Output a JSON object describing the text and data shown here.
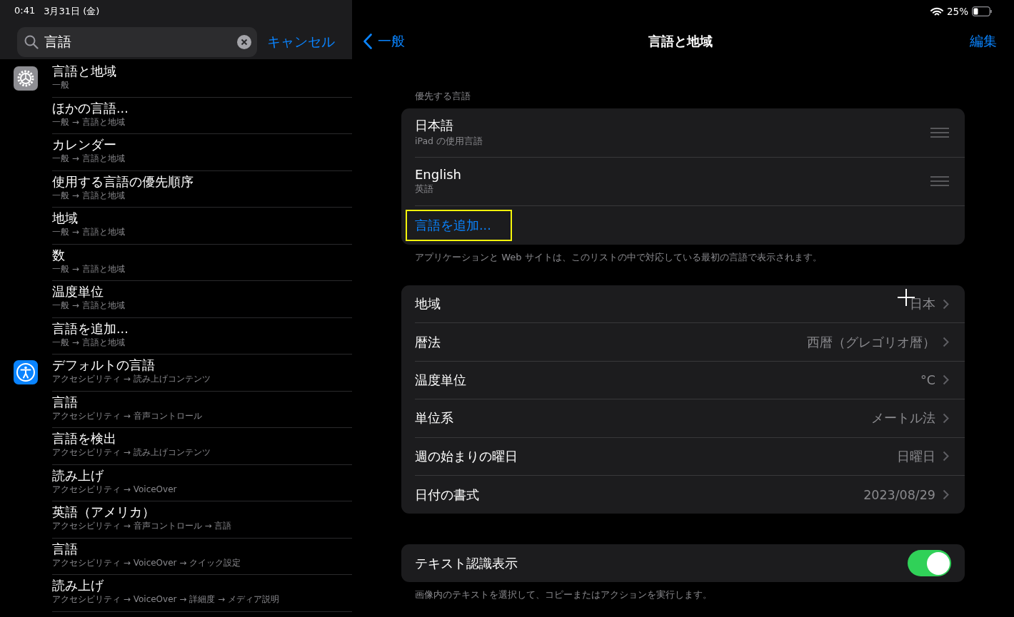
{
  "status_bar": {
    "time": "0:41",
    "date": "3月31日 (金)",
    "battery": "25%"
  },
  "search": {
    "value": "言語",
    "cancel": "キャンセル"
  },
  "results": [
    {
      "kind": "gear",
      "items": [
        {
          "title": "言語と地域",
          "path": "一般"
        },
        {
          "title": "ほかの言語...",
          "path": "一般 → 言語と地域"
        },
        {
          "title": "カレンダー",
          "path": "一般 → 言語と地域"
        },
        {
          "title": "使用する言語の優先順序",
          "path": "一般 → 言語と地域"
        },
        {
          "title": "地域",
          "path": "一般 → 言語と地域"
        },
        {
          "title": "数",
          "path": "一般 → 言語と地域"
        },
        {
          "title": "温度単位",
          "path": "一般 → 言語と地域"
        },
        {
          "title": "言語を追加...",
          "path": "一般 → 言語と地域"
        }
      ]
    },
    {
      "kind": "accessibility",
      "items": [
        {
          "title": "デフォルトの言語",
          "path": "アクセシビリティ → 読み上げコンテンツ"
        },
        {
          "title": "言語",
          "path": "アクセシビリティ → 音声コントロール"
        },
        {
          "title": "言語を検出",
          "path": "アクセシビリティ → 読み上げコンテンツ"
        },
        {
          "title": "読み上げ",
          "path": "アクセシビリティ → VoiceOver"
        },
        {
          "title": "英語（アメリカ）",
          "path": "アクセシビリティ → 音声コントロール → 言語"
        },
        {
          "title": "言語",
          "path": "アクセシビリティ → VoiceOver → クイック設定"
        },
        {
          "title": "読み上げ",
          "path": "アクセシビリティ → VoiceOver → 詳細度 → メディア説明"
        }
      ]
    }
  ],
  "nav": {
    "back": "一般",
    "title": "言語と地域",
    "edit": "編集"
  },
  "preferred": {
    "header": "優先する言語",
    "languages": [
      {
        "name": "日本語",
        "detail": "iPad の使用言語"
      },
      {
        "name": "English",
        "detail": "英語"
      }
    ],
    "add": {
      "label": "言語を追加...",
      "highlighted": true
    },
    "footer": "アプリケーションと Web サイトは、このリストの中で対応している最初の言語で表示されます。"
  },
  "region_settings": [
    {
      "label": "地域",
      "value": "日本"
    },
    {
      "label": "暦法",
      "value": "西暦（グレゴリオ暦）"
    },
    {
      "label": "温度単位",
      "value": "°C"
    },
    {
      "label": "単位系",
      "value": "メートル法"
    },
    {
      "label": "週の始まりの曜日",
      "value": "日曜日"
    },
    {
      "label": "日付の書式",
      "value": "2023/08/29"
    }
  ],
  "live_text": {
    "label": "テキスト認識表示",
    "on": true,
    "footer": "画像内のテキストを選択して、コピーまたはアクションを実行します。"
  }
}
